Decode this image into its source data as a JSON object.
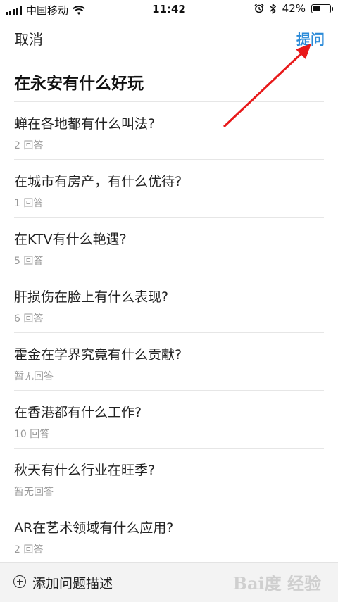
{
  "status_bar": {
    "carrier": "中国移动",
    "time": "11:42",
    "battery_text": "42%",
    "battery_level": 0.42,
    "icons": [
      "signal-icon",
      "wifi-icon",
      "alarm-icon",
      "bluetooth-icon",
      "battery-icon"
    ]
  },
  "nav": {
    "cancel_label": "取消",
    "ask_label": "提问",
    "ask_color": "#2a8ad8"
  },
  "query": {
    "title": "在永安有什么好玩"
  },
  "questions": [
    {
      "title": "蝉在各地都有什么叫法?",
      "answers": "2 回答"
    },
    {
      "title": "在城市有房产，有什么优待?",
      "answers": "1 回答"
    },
    {
      "title": "在KTV有什么艳遇?",
      "answers": "5 回答"
    },
    {
      "title": "肝损伤在脸上有什么表现?",
      "answers": "6 回答"
    },
    {
      "title": "霍金在学界究竟有什么贡献?",
      "answers": "暂无回答"
    },
    {
      "title": "在香港都有什么工作?",
      "answers": "10 回答"
    },
    {
      "title": "秋天有什么行业在旺季?",
      "answers": "暂无回答"
    },
    {
      "title": "AR在艺术领域有什么应用?",
      "answers": "2 回答"
    }
  ],
  "bottom": {
    "add_label": "添加问题描述",
    "watermark": "Bai度 经验"
  },
  "annotation": {
    "arrow_color": "#e8191a"
  }
}
